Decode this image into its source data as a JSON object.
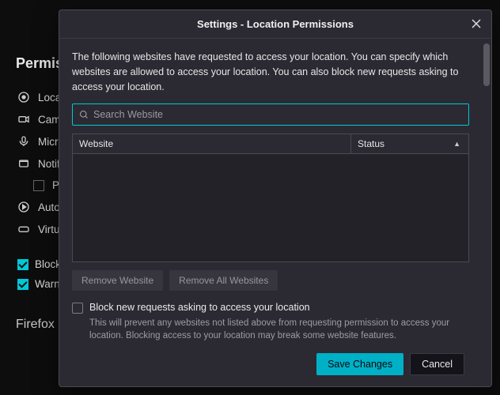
{
  "background": {
    "heading": "Permissions",
    "items": {
      "location": "Location",
      "camera": "Camera",
      "microphone": "Microphone",
      "notifications": "Notifications",
      "pause": "Pause",
      "autoplay": "Autoplay",
      "virtual": "Virtual"
    },
    "block_popups": "Block popup windows",
    "warn_addons": "Warn you when websites try to install add-ons",
    "section2": "Firefox Data Collection and Use"
  },
  "modal": {
    "title": "Settings - Location Permissions",
    "description": "The following websites have requested to access your location. You can specify which websites are allowed to access your location. You can also block new requests asking to access your location.",
    "search_placeholder": "Search Website",
    "columns": {
      "website": "Website",
      "status": "Status"
    },
    "buttons": {
      "remove_website": "Remove Website",
      "remove_all": "Remove All Websites",
      "save": "Save Changes",
      "cancel": "Cancel"
    },
    "block_new": {
      "label": "Block new requests asking to access your location",
      "desc": "This will prevent any websites not listed above from requesting permission to access your location. Blocking access to your location may break some website features."
    }
  }
}
